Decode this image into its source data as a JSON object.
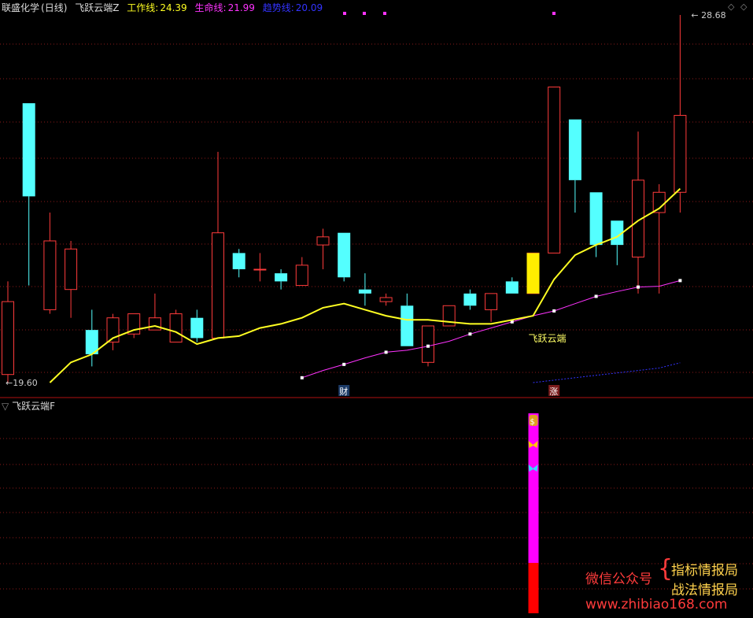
{
  "header": {
    "stock_name": "联盛化学",
    "period": "(日线)",
    "indicator_name": "飞跃云端Z",
    "work_line_label": "工作线:",
    "work_line_value": "24.39",
    "life_line_label": "生命线:",
    "life_line_value": "21.99",
    "trend_line_label": "趋势线:",
    "trend_line_value": "20.09"
  },
  "colors": {
    "up": "#ff3b3b",
    "down": "#54ffff",
    "work_line": "#ffff22",
    "life_line": "#ff33ff",
    "trend_line": "#3333ff",
    "grid": "#8b1a1a",
    "signal_bar": "#ff00ff",
    "signal_base": "#ff0000"
  },
  "chart_data": {
    "type": "candlestick",
    "high_label": "28.68",
    "low_label": "19.60",
    "candles": [
      {
        "o": 19.8,
        "c": 21.6,
        "h": 22.1,
        "l": 19.6
      },
      {
        "o": 26.5,
        "c": 24.2,
        "h": 26.5,
        "l": 22.0
      },
      {
        "o": 21.4,
        "c": 23.1,
        "h": 23.8,
        "l": 21.3
      },
      {
        "o": 21.9,
        "c": 22.9,
        "h": 23.1,
        "l": 21.2
      },
      {
        "o": 20.9,
        "c": 20.3,
        "h": 21.4,
        "l": 20.0
      },
      {
        "o": 20.6,
        "c": 21.2,
        "h": 21.3,
        "l": 20.4
      },
      {
        "o": 20.8,
        "c": 21.3,
        "h": 21.3,
        "l": 20.7
      },
      {
        "o": 20.9,
        "c": 21.2,
        "h": 21.8,
        "l": 20.9
      },
      {
        "o": 20.6,
        "c": 21.3,
        "h": 21.4,
        "l": 20.6
      },
      {
        "o": 21.2,
        "c": 20.7,
        "h": 21.4,
        "l": 20.6
      },
      {
        "o": 20.7,
        "c": 23.3,
        "h": 25.3,
        "l": 20.7
      },
      {
        "o": 22.8,
        "c": 22.4,
        "h": 22.9,
        "l": 22.2
      },
      {
        "o": 22.4,
        "c": 22.4,
        "h": 22.8,
        "l": 22.1
      },
      {
        "o": 22.3,
        "c": 22.1,
        "h": 22.4,
        "l": 21.9
      },
      {
        "o": 22.0,
        "c": 22.5,
        "h": 22.7,
        "l": 22.0
      },
      {
        "o": 23.0,
        "c": 23.2,
        "h": 23.4,
        "l": 22.4
      },
      {
        "o": 23.3,
        "c": 22.2,
        "h": 23.3,
        "l": 22.1
      },
      {
        "o": 21.9,
        "c": 21.8,
        "h": 22.3,
        "l": 21.5
      },
      {
        "o": 21.6,
        "c": 21.7,
        "h": 21.8,
        "l": 21.5
      },
      {
        "o": 21.5,
        "c": 20.5,
        "h": 21.8,
        "l": 20.5
      },
      {
        "o": 20.1,
        "c": 21.0,
        "h": 21.0,
        "l": 20.0
      },
      {
        "o": 21.0,
        "c": 21.5,
        "h": 21.5,
        "l": 21.0
      },
      {
        "o": 21.8,
        "c": 21.5,
        "h": 21.9,
        "l": 21.4
      },
      {
        "o": 21.4,
        "c": 21.8,
        "h": 21.8,
        "l": 21.1
      },
      {
        "o": 22.1,
        "c": 21.8,
        "h": 22.2,
        "l": 21.8
      },
      {
        "o": 21.8,
        "c": 22.8,
        "h": 22.8,
        "l": 21.8
      },
      {
        "o": 22.8,
        "c": 26.9,
        "h": 26.9,
        "l": 22.8
      },
      {
        "o": 26.1,
        "c": 24.6,
        "h": 26.1,
        "l": 23.8
      },
      {
        "o": 24.3,
        "c": 23.0,
        "h": 24.3,
        "l": 22.7
      },
      {
        "o": 23.6,
        "c": 23.0,
        "h": 23.6,
        "l": 22.5
      },
      {
        "o": 22.7,
        "c": 24.6,
        "h": 25.8,
        "l": 21.8
      },
      {
        "o": 23.8,
        "c": 24.3,
        "h": 24.5,
        "l": 21.8
      },
      {
        "o": 24.3,
        "c": 26.2,
        "h": 28.68,
        "l": 23.8
      }
    ],
    "work_line": [
      null,
      null,
      19.6,
      20.1,
      20.3,
      20.7,
      20.9,
      21.0,
      20.85,
      20.55,
      20.7,
      20.75,
      20.95,
      21.05,
      21.2,
      21.45,
      21.55,
      21.4,
      21.25,
      21.15,
      21.15,
      21.1,
      21.05,
      21.05,
      21.15,
      21.25,
      22.15,
      22.75,
      23.0,
      23.2,
      23.6,
      23.9,
      24.39
    ],
    "life_line": [
      null,
      null,
      null,
      null,
      null,
      null,
      null,
      null,
      null,
      null,
      null,
      null,
      null,
      null,
      19.72,
      19.9,
      20.05,
      20.21,
      20.35,
      20.4,
      20.5,
      20.62,
      20.8,
      20.95,
      21.1,
      21.25,
      21.37,
      21.55,
      21.73,
      21.85,
      21.96,
      21.98,
      22.12
    ],
    "trend_line": [
      null,
      null,
      null,
      null,
      null,
      null,
      null,
      null,
      null,
      null,
      null,
      null,
      null,
      null,
      null,
      null,
      null,
      null,
      null,
      null,
      null,
      null,
      null,
      null,
      null,
      19.6,
      19.66,
      19.72,
      19.78,
      19.84,
      19.9,
      19.96,
      20.09
    ],
    "annotations": [
      {
        "text": "飞跃云端",
        "index": 25
      },
      {
        "text": "财",
        "index": 16
      },
      {
        "text": "涨",
        "index": 26
      }
    ],
    "signal_index": 25
  },
  "sub_panel": {
    "title": "飞跃云端F"
  },
  "watermark": {
    "left": "微信公众号",
    "right1": "指标情报局",
    "right2": "战法情报局",
    "url": "www.zhibiao168.com"
  }
}
